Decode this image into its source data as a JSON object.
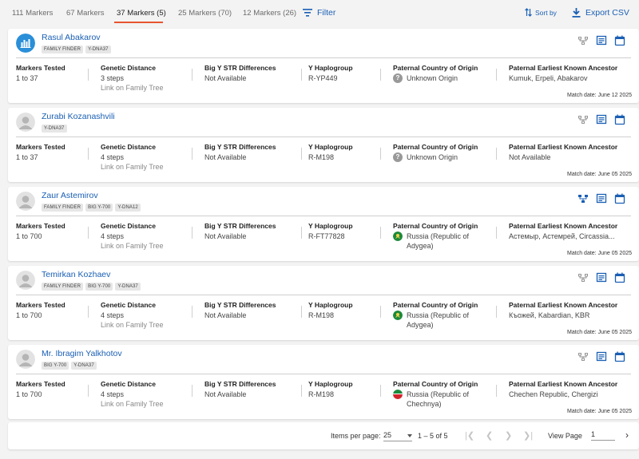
{
  "tabs": [
    {
      "label": "111 Markers"
    },
    {
      "label": "67 Markers"
    },
    {
      "label": "37 Markers (5)"
    },
    {
      "label": "25 Markers (70)"
    },
    {
      "label": "12 Markers (26)"
    }
  ],
  "toolbar": {
    "filter_label": "Filter",
    "sort_label": "Sort by",
    "export_label": "Export CSV"
  },
  "colors": {
    "accent": "#1a5fb4",
    "tab_active_underline": "#e8542f"
  },
  "columns": {
    "markers_tested": "Markers Tested",
    "genetic_distance": "Genetic Distance",
    "big_y": "Big Y STR Differences",
    "haplogroup": "Y Haplogroup",
    "country": "Paternal Country of Origin",
    "ancestor": "Paternal Earliest Known Ancestor"
  },
  "link_family_tree": "Link on Family Tree",
  "matches": [
    {
      "name": "Rasul Abakarov",
      "avatar": "chart-avatar",
      "tags": [
        "FAMILY FINDER",
        "Y-DNA37"
      ],
      "markers_tested": "1 to 37",
      "genetic_distance": "3 steps",
      "big_y": "Not Available",
      "haplogroup": "R-YP449",
      "country": "Unknown Origin",
      "country_icon": "question-icon",
      "ancestor": "Kumuk, Erpeli, Abakarov",
      "match_date": "Match date: June 12 2025",
      "tree_icon_active": false
    },
    {
      "name": "Zurabi Kozanashvili",
      "avatar": "person-avatar",
      "tags": [
        "Y-DNA37"
      ],
      "markers_tested": "1 to 37",
      "genetic_distance": "4 steps",
      "big_y": "Not Available",
      "haplogroup": "R-M198",
      "country": "Unknown Origin",
      "country_icon": "question-icon",
      "ancestor": "Not Available",
      "match_date": "Match date: June 05 2025",
      "tree_icon_active": false
    },
    {
      "name": "Zaur Astemirov",
      "avatar": "person-avatar",
      "tags": [
        "FAMILY FINDER",
        "BIG Y-700",
        "Y-DNA12"
      ],
      "markers_tested": "1 to 700",
      "genetic_distance": "4 steps",
      "big_y": "Not Available",
      "haplogroup": "R-FT77828",
      "country": "Russia (Republic of Adygea)",
      "country_icon": "adygea-flag",
      "ancestor": "Астемыр, Астемрей, Circassia...",
      "match_date": "Match date: June 05 2025",
      "tree_icon_active": true
    },
    {
      "name": "Temirkan Kozhaev",
      "avatar": "person-avatar",
      "tags": [
        "FAMILY FINDER",
        "BIG Y-700",
        "Y-DNA37"
      ],
      "markers_tested": "1 to 700",
      "genetic_distance": "4 steps",
      "big_y": "Not Available",
      "haplogroup": "R-M198",
      "country": "Russia (Republic of Adygea)",
      "country_icon": "adygea-flag",
      "ancestor": "Къожей, Kabardian, KBR",
      "match_date": "Match date: June 05 2025",
      "tree_icon_active": false
    },
    {
      "name": "Mr. Ibragim Yalkhotov",
      "avatar": "person-avatar",
      "tags": [
        "BIG Y-700",
        "Y-DNA37"
      ],
      "markers_tested": "1 to 700",
      "genetic_distance": "4 steps",
      "big_y": "Not Available",
      "haplogroup": "R-M198",
      "country": "Russia (Republic of Chechnya)",
      "country_icon": "chechnya-flag",
      "ancestor": "Chechen Republic, Chergizi",
      "match_date": "Match date: June 05 2025",
      "tree_icon_active": false
    }
  ],
  "pagination": {
    "items_per_page_label": "Items per page:",
    "items_per_page_value": "25",
    "range": "1 – 5 of 5",
    "view_page_label": "View Page",
    "page_value": "1"
  }
}
